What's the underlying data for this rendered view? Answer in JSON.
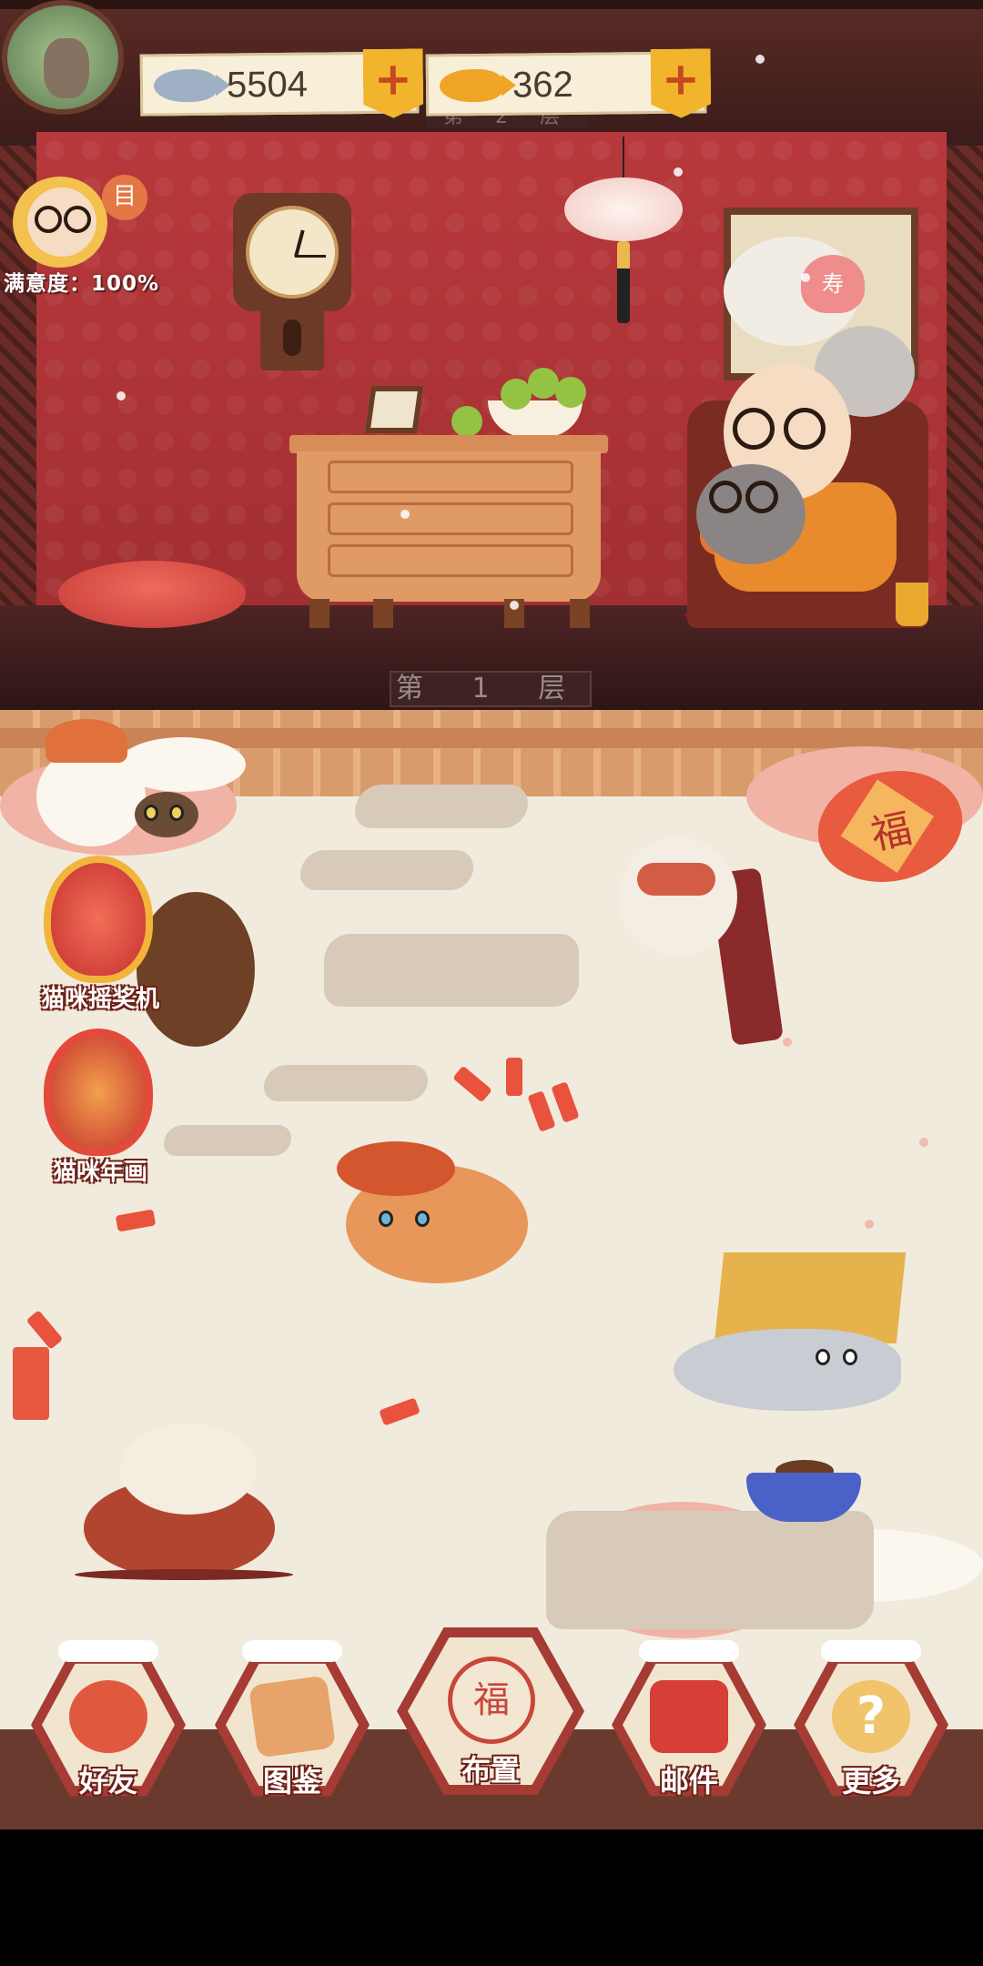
{
  "hud": {
    "fish_silver": "5504",
    "fish_gold": "362",
    "add_label": "+",
    "satisfaction": "满意度：100%",
    "menu_glyph": "目"
  },
  "floors": {
    "upper_sign": "第 2 层",
    "lower_sign": "第 1 层"
  },
  "decor": {
    "peach_char": "寿",
    "jar_char": "福"
  },
  "side_buttons": [
    {
      "label": "猫咪摇奖机"
    },
    {
      "label": "猫咪年画"
    }
  ],
  "nav": [
    {
      "label": "好友",
      "icon": "friends-icon"
    },
    {
      "label": "图鉴",
      "icon": "catalog-book-icon"
    },
    {
      "label": "布置",
      "icon": "fu-jar-icon",
      "glyph": "福"
    },
    {
      "label": "邮件",
      "icon": "red-envelope-icon"
    },
    {
      "label": "更多",
      "icon": "question-cat-icon",
      "glyph": "?"
    }
  ],
  "colors": {
    "wall": "#b8393c",
    "snow": "#f1ebdd",
    "accent_gold": "#f2b42c",
    "nav_red": "#a53b33"
  }
}
